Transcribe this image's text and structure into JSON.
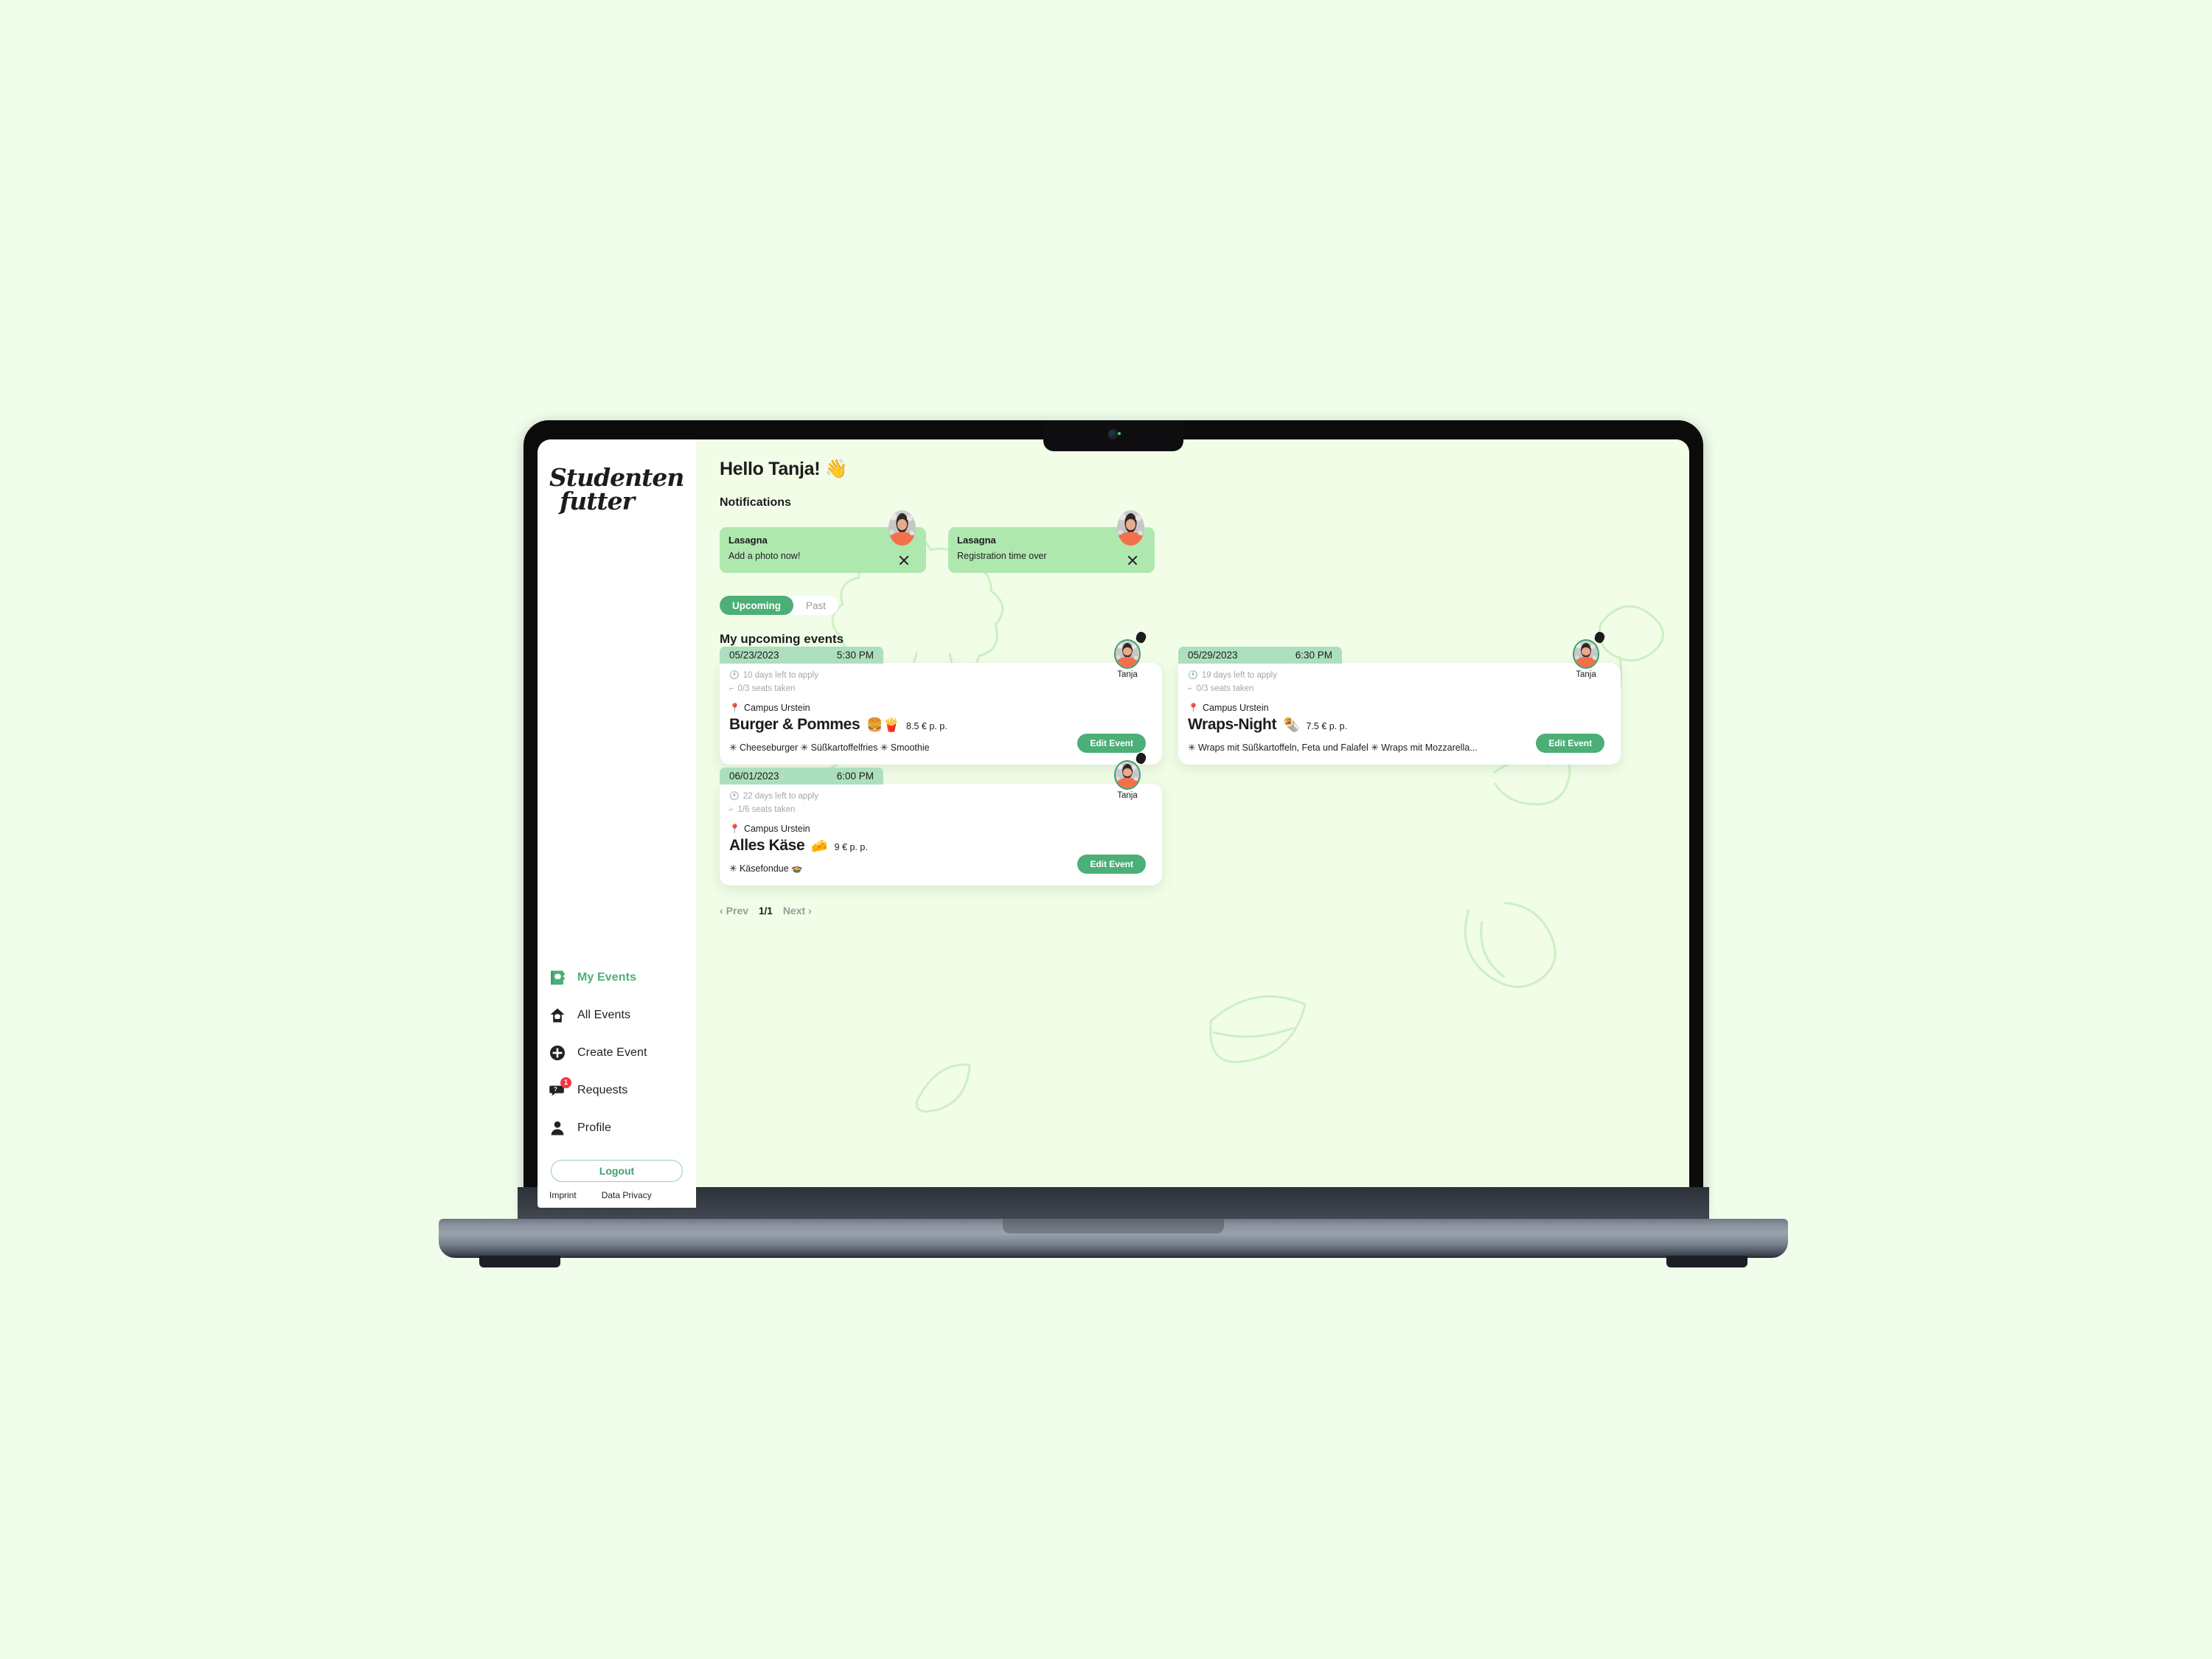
{
  "theme": {
    "page_bg": "#F0FDEB",
    "screen_bg": "#F1FDE7",
    "accent_green": "#4CAF78",
    "mint_chip": "#ACDFBD",
    "notification_green": "#AEE8AF",
    "badge_red": "#F5333F"
  },
  "brand": {
    "line1": "Studenten",
    "line2": "futter"
  },
  "sidebar": {
    "items": [
      {
        "label": "My Events",
        "icon": "cookbook-icon",
        "active": true,
        "badge": ""
      },
      {
        "label": "All Events",
        "icon": "house-chef-icon",
        "active": false,
        "badge": ""
      },
      {
        "label": "Create Event",
        "icon": "plus-circle-icon",
        "active": false,
        "badge": ""
      },
      {
        "label": "Requests",
        "icon": "speech-bubble-question-icon",
        "active": false,
        "badge": "1"
      },
      {
        "label": "Profile",
        "icon": "person-icon",
        "active": false,
        "badge": ""
      }
    ],
    "logout_label": "Logout",
    "footer": {
      "imprint": "Imprint",
      "data_privacy": "Data Privacy"
    }
  },
  "main": {
    "greeting": "Hello Tanja! 👋",
    "notifications_title": "Notifications",
    "notifications": [
      {
        "title": "Lasagna",
        "message": "Add a photo now!"
      },
      {
        "title": "Lasagna",
        "message": "Registration time over"
      }
    ],
    "tabs": [
      {
        "label": "Upcoming",
        "active": true
      },
      {
        "label": "Past",
        "active": false
      }
    ],
    "events_title": "My upcoming events",
    "events": [
      {
        "date": "05/23/2023",
        "time": "5:30 PM",
        "days_left": "10 days left to apply",
        "seats": "0/3 seats taken",
        "location": "Campus Urstein",
        "name": "Burger & Pommes",
        "emoji": "🍔🍟",
        "price": "8.5 € p. p.",
        "menu": "✳ Cheeseburger  ✳ Süßkartoffelfries  ✳ Smoothie",
        "host": "Tanja",
        "button": "Edit Event"
      },
      {
        "date": "05/29/2023",
        "time": "6:30 PM",
        "days_left": "19 days left to apply",
        "seats": "0/3 seats taken",
        "location": "Campus Urstein",
        "name": "Wraps-Night",
        "emoji": "🌯",
        "price": "7.5 € p. p.",
        "menu": "✳ Wraps mit Süßkartoffeln, Feta und Falafel  ✳ Wraps mit Mozzarella...",
        "host": "Tanja",
        "button": "Edit Event"
      },
      {
        "date": "06/01/2023",
        "time": "6:00 PM",
        "days_left": "22 days left to apply",
        "seats": "1/6 seats taken",
        "location": "Campus Urstein",
        "name": "Alles Käse",
        "emoji": "🧀",
        "price": "9 € p. p.",
        "menu": "✳ Käsefondue 🍲",
        "host": "Tanja",
        "button": "Edit Event"
      }
    ],
    "pagination": {
      "prev": "Prev",
      "indicator": "1/1",
      "next": "Next"
    }
  }
}
